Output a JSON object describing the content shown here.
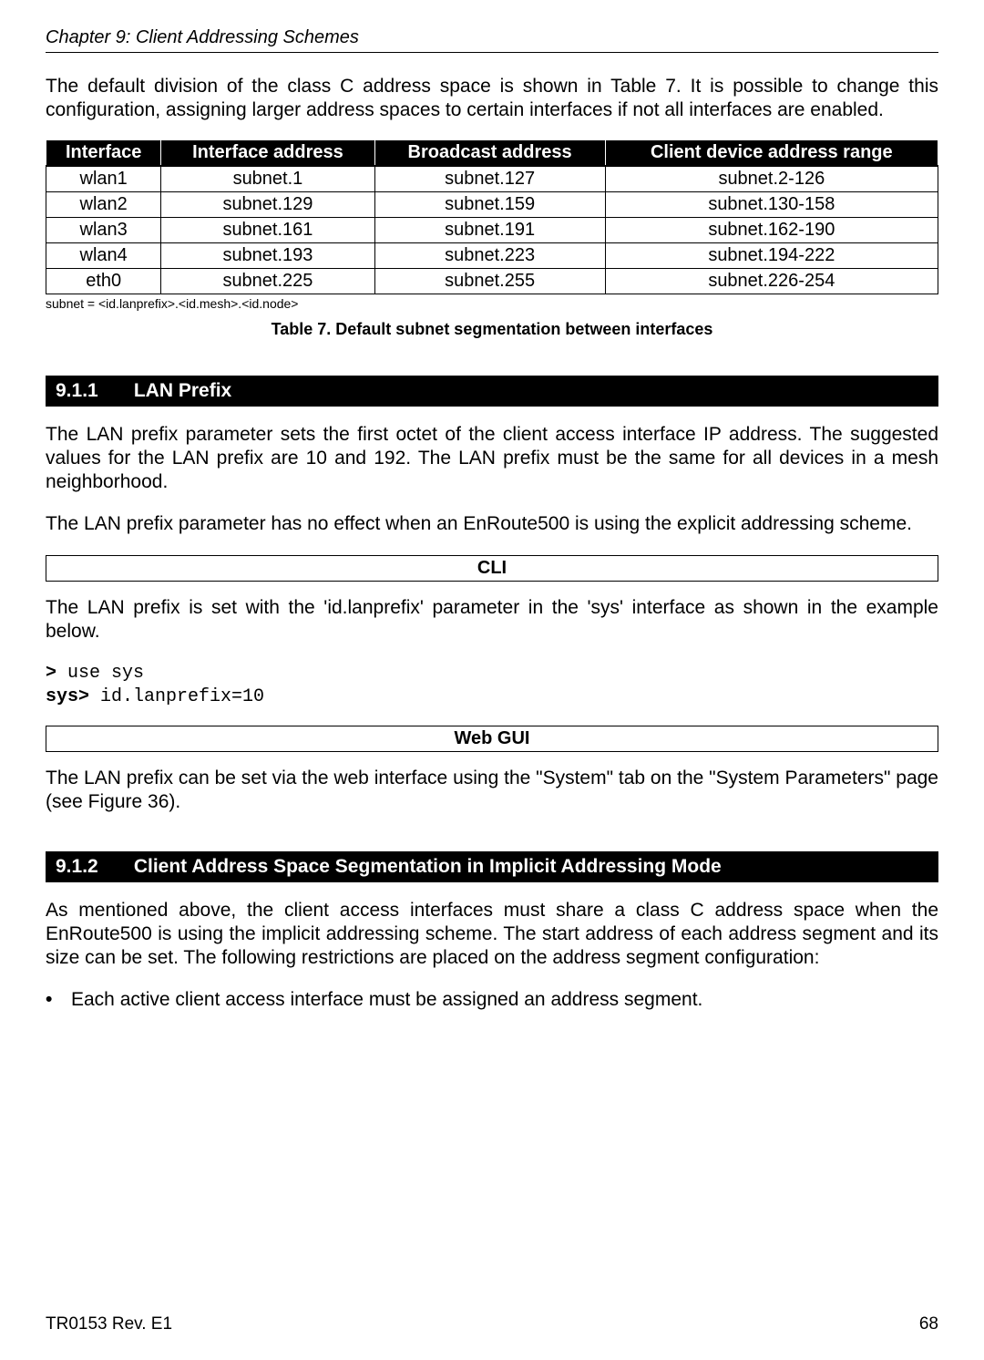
{
  "header": {
    "chapter": "Chapter 9: Client Addressing Schemes"
  },
  "intro": "The default division of the class C address space is shown in Table 7. It is possible to change this configuration, assigning larger address spaces to certain interfaces if not all interfaces are enabled.",
  "table": {
    "headers": [
      "Interface",
      "Interface address",
      "Broadcast address",
      "Client device address range"
    ],
    "rows": [
      [
        "wlan1",
        "subnet.1",
        "subnet.127",
        "subnet.2-126"
      ],
      [
        "wlan2",
        "subnet.129",
        "subnet.159",
        "subnet.130-158"
      ],
      [
        "wlan3",
        "subnet.161",
        "subnet.191",
        "subnet.162-190"
      ],
      [
        "wlan4",
        "subnet.193",
        "subnet.223",
        "subnet.194-222"
      ],
      [
        "eth0",
        "subnet.225",
        "subnet.255",
        "subnet.226-254"
      ]
    ],
    "note": "subnet = <id.lanprefix>.<id.mesh>.<id.node>",
    "caption": "Table 7. Default subnet segmentation between interfaces"
  },
  "section_911": {
    "num": "9.1.1",
    "title": "LAN Prefix",
    "p1": "The LAN prefix parameter sets the first octet of the client access interface IP address. The suggested values for the LAN prefix are 10 and 192. The LAN prefix must be the same for all devices in a mesh neighborhood.",
    "p2": "The LAN prefix parameter has no effect when an EnRoute500 is using the explicit addressing scheme.",
    "cli_label": "CLI",
    "cli_para": "The LAN prefix is set with the 'id.lanprefix' parameter in the 'sys' interface as shown in the example below.",
    "code_prompt1": ">",
    "code_cmd1": " use sys",
    "code_prompt2": "sys>",
    "code_cmd2": " id.lanprefix=10",
    "web_label": "Web GUI",
    "web_para": "The LAN prefix can be set via the web interface using the \"System\" tab on the \"System Parameters\" page (see Figure 36)."
  },
  "section_912": {
    "num": "9.1.2",
    "title": "Client Address Space Segmentation in Implicit Addressing Mode",
    "p1": "As mentioned above, the client access interfaces must share a class C address space when the EnRoute500 is using the implicit addressing scheme. The start address of each address segment and its size can be set. The following restrictions are placed on the address segment configuration:",
    "bullet1": "Each active client access interface must be assigned an address segment."
  },
  "footer": {
    "left": "TR0153 Rev. E1",
    "right": "68"
  }
}
